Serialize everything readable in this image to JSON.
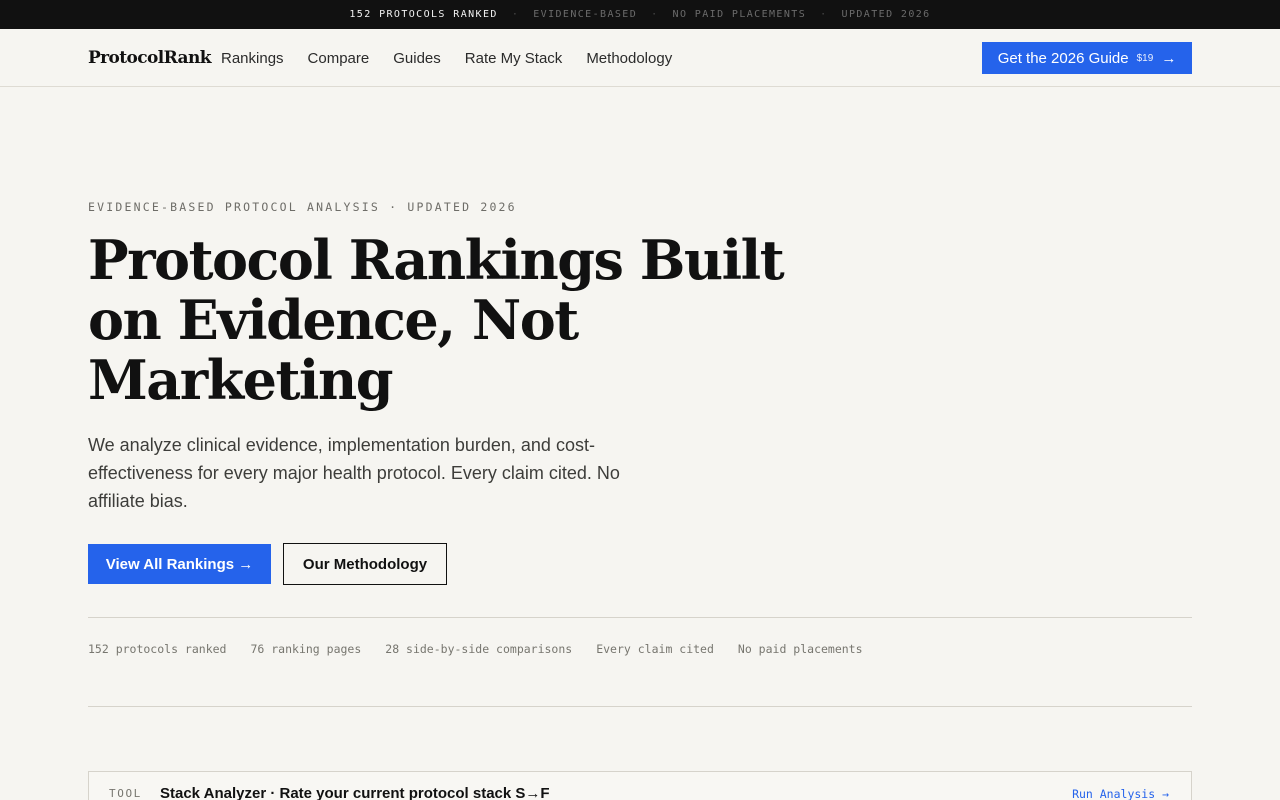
{
  "announcement": {
    "items": [
      "152 PROTOCOLS RANKED",
      "EVIDENCE-BASED",
      "NO PAID PLACEMENTS",
      "UPDATED 2026"
    ],
    "separator": "·"
  },
  "nav": {
    "logo": "ProtocolRank",
    "links": [
      "Rankings",
      "Compare",
      "Guides",
      "Rate My Stack",
      "Methodology"
    ],
    "cta": {
      "label": "Get the 2026 Guide",
      "price": "$19",
      "arrow": "→"
    }
  },
  "hero": {
    "eyebrow": "EVIDENCE-BASED PROTOCOL ANALYSIS · UPDATED 2026",
    "headline": "Protocol Rankings Built on Evidence, Not Marketing",
    "subhead": "We analyze clinical evidence, implementation burden, and cost-effectiveness for every major health protocol. Every claim cited. No affiliate bias.",
    "primary_button": "View All Rankings →",
    "secondary_button": "Our Methodology"
  },
  "stats": [
    "152 protocols ranked",
    "76 ranking pages",
    "28 side-by-side comparisons",
    "Every claim cited",
    "No paid placements"
  ],
  "tool_card": {
    "tag": "TOOL",
    "title": "Stack Analyzer · Rate your current protocol stack S→F",
    "action": "Run Analysis →"
  },
  "colors": {
    "accent": "#2563eb",
    "topbar_bg": "#111111",
    "page_bg": "#f6f5f1"
  }
}
